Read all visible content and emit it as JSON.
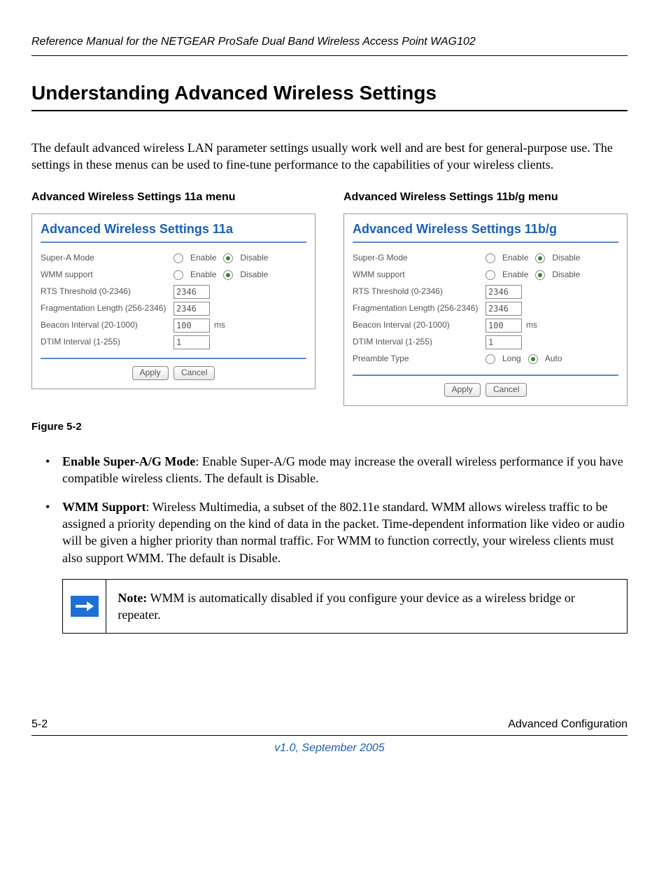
{
  "header": "Reference Manual for the NETGEAR ProSafe Dual Band Wireless Access Point WAG102",
  "title": "Understanding Advanced Wireless Settings",
  "intro": "The default advanced wireless LAN parameter settings usually work well and are best for general-purpose use. The settings in these menus can be used to fine-tune performance to the capabilities of your wireless clients.",
  "menus": {
    "left": {
      "heading": "Advanced Wireless Settings 11a menu",
      "panel_title": "Advanced Wireless Settings 11a",
      "super_label": "Super-A Mode",
      "rows": {
        "wmm": "WMM support",
        "rts": "RTS Threshold (0-2346)",
        "frag": "Fragmentation Length (256-2346)",
        "beacon": "Beacon Interval (20-1000)",
        "dtim": "DTIM Interval (1-255)"
      },
      "values": {
        "rts": "2346",
        "frag": "2346",
        "beacon": "100",
        "dtim": "1"
      },
      "radio": {
        "enable": "Enable",
        "disable": "Disable"
      },
      "unit_ms": "ms",
      "buttons": {
        "apply": "Apply",
        "cancel": "Cancel"
      }
    },
    "right": {
      "heading": "Advanced Wireless Settings 11b/g menu",
      "panel_title": "Advanced Wireless Settings 11b/g",
      "super_label": "Super-G Mode",
      "rows": {
        "wmm": "WMM support",
        "rts": "RTS Threshold (0-2346)",
        "frag": "Fragmentation Length (256-2346)",
        "beacon": "Beacon Interval (20-1000)",
        "dtim": "DTIM Interval (1-255)",
        "preamble": "Preamble Type"
      },
      "values": {
        "rts": "2346",
        "frag": "2346",
        "beacon": "100",
        "dtim": "1"
      },
      "radio": {
        "enable": "Enable",
        "disable": "Disable",
        "long": "Long",
        "auto": "Auto"
      },
      "unit_ms": "ms",
      "buttons": {
        "apply": "Apply",
        "cancel": "Cancel"
      }
    }
  },
  "figure_caption": "Figure 5-2",
  "bullets": [
    {
      "lead": "Enable Super-A/G Mode",
      "text": ": Enable Super-A/G mode may increase the overall wireless performance if you have compatible wireless clients. The default is Disable."
    },
    {
      "lead": "WMM Support",
      "text": ": Wireless Multimedia, a subset of the 802.11e standard. WMM allows wireless traffic to be assigned a priority depending on the kind of data in the packet. Time-dependent information like video or audio will be given a higher priority than normal traffic. For WMM to function correctly, your wireless clients must also support WMM. The default is Disable."
    }
  ],
  "note": {
    "lead": "Note:",
    "text": " WMM is automatically disabled if you configure your device as a wireless bridge or repeater."
  },
  "footer": {
    "left": "5-2",
    "right": "Advanced Configuration",
    "center": "v1.0, September 2005"
  }
}
